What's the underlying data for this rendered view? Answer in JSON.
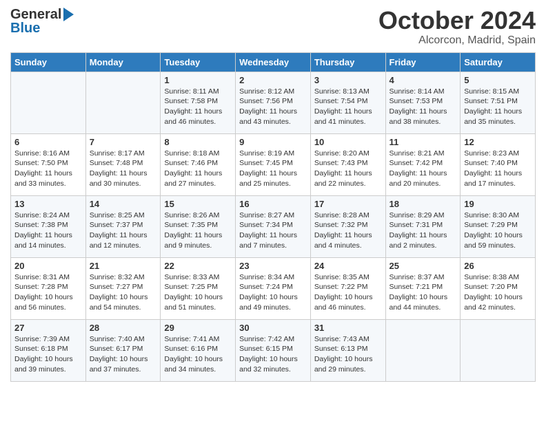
{
  "header": {
    "logo_text_general": "General",
    "logo_text_blue": "Blue",
    "month_title": "October 2024",
    "location": "Alcorcon, Madrid, Spain"
  },
  "calendar": {
    "days_of_week": [
      "Sunday",
      "Monday",
      "Tuesday",
      "Wednesday",
      "Thursday",
      "Friday",
      "Saturday"
    ],
    "weeks": [
      [
        {
          "day": "",
          "content": ""
        },
        {
          "day": "",
          "content": ""
        },
        {
          "day": "1",
          "content": "Sunrise: 8:11 AM\nSunset: 7:58 PM\nDaylight: 11 hours and 46 minutes."
        },
        {
          "day": "2",
          "content": "Sunrise: 8:12 AM\nSunset: 7:56 PM\nDaylight: 11 hours and 43 minutes."
        },
        {
          "day": "3",
          "content": "Sunrise: 8:13 AM\nSunset: 7:54 PM\nDaylight: 11 hours and 41 minutes."
        },
        {
          "day": "4",
          "content": "Sunrise: 8:14 AM\nSunset: 7:53 PM\nDaylight: 11 hours and 38 minutes."
        },
        {
          "day": "5",
          "content": "Sunrise: 8:15 AM\nSunset: 7:51 PM\nDaylight: 11 hours and 35 minutes."
        }
      ],
      [
        {
          "day": "6",
          "content": "Sunrise: 8:16 AM\nSunset: 7:50 PM\nDaylight: 11 hours and 33 minutes."
        },
        {
          "day": "7",
          "content": "Sunrise: 8:17 AM\nSunset: 7:48 PM\nDaylight: 11 hours and 30 minutes."
        },
        {
          "day": "8",
          "content": "Sunrise: 8:18 AM\nSunset: 7:46 PM\nDaylight: 11 hours and 27 minutes."
        },
        {
          "day": "9",
          "content": "Sunrise: 8:19 AM\nSunset: 7:45 PM\nDaylight: 11 hours and 25 minutes."
        },
        {
          "day": "10",
          "content": "Sunrise: 8:20 AM\nSunset: 7:43 PM\nDaylight: 11 hours and 22 minutes."
        },
        {
          "day": "11",
          "content": "Sunrise: 8:21 AM\nSunset: 7:42 PM\nDaylight: 11 hours and 20 minutes."
        },
        {
          "day": "12",
          "content": "Sunrise: 8:23 AM\nSunset: 7:40 PM\nDaylight: 11 hours and 17 minutes."
        }
      ],
      [
        {
          "day": "13",
          "content": "Sunrise: 8:24 AM\nSunset: 7:38 PM\nDaylight: 11 hours and 14 minutes."
        },
        {
          "day": "14",
          "content": "Sunrise: 8:25 AM\nSunset: 7:37 PM\nDaylight: 11 hours and 12 minutes."
        },
        {
          "day": "15",
          "content": "Sunrise: 8:26 AM\nSunset: 7:35 PM\nDaylight: 11 hours and 9 minutes."
        },
        {
          "day": "16",
          "content": "Sunrise: 8:27 AM\nSunset: 7:34 PM\nDaylight: 11 hours and 7 minutes."
        },
        {
          "day": "17",
          "content": "Sunrise: 8:28 AM\nSunset: 7:32 PM\nDaylight: 11 hours and 4 minutes."
        },
        {
          "day": "18",
          "content": "Sunrise: 8:29 AM\nSunset: 7:31 PM\nDaylight: 11 hours and 2 minutes."
        },
        {
          "day": "19",
          "content": "Sunrise: 8:30 AM\nSunset: 7:29 PM\nDaylight: 10 hours and 59 minutes."
        }
      ],
      [
        {
          "day": "20",
          "content": "Sunrise: 8:31 AM\nSunset: 7:28 PM\nDaylight: 10 hours and 56 minutes."
        },
        {
          "day": "21",
          "content": "Sunrise: 8:32 AM\nSunset: 7:27 PM\nDaylight: 10 hours and 54 minutes."
        },
        {
          "day": "22",
          "content": "Sunrise: 8:33 AM\nSunset: 7:25 PM\nDaylight: 10 hours and 51 minutes."
        },
        {
          "day": "23",
          "content": "Sunrise: 8:34 AM\nSunset: 7:24 PM\nDaylight: 10 hours and 49 minutes."
        },
        {
          "day": "24",
          "content": "Sunrise: 8:35 AM\nSunset: 7:22 PM\nDaylight: 10 hours and 46 minutes."
        },
        {
          "day": "25",
          "content": "Sunrise: 8:37 AM\nSunset: 7:21 PM\nDaylight: 10 hours and 44 minutes."
        },
        {
          "day": "26",
          "content": "Sunrise: 8:38 AM\nSunset: 7:20 PM\nDaylight: 10 hours and 42 minutes."
        }
      ],
      [
        {
          "day": "27",
          "content": "Sunrise: 7:39 AM\nSunset: 6:18 PM\nDaylight: 10 hours and 39 minutes."
        },
        {
          "day": "28",
          "content": "Sunrise: 7:40 AM\nSunset: 6:17 PM\nDaylight: 10 hours and 37 minutes."
        },
        {
          "day": "29",
          "content": "Sunrise: 7:41 AM\nSunset: 6:16 PM\nDaylight: 10 hours and 34 minutes."
        },
        {
          "day": "30",
          "content": "Sunrise: 7:42 AM\nSunset: 6:15 PM\nDaylight: 10 hours and 32 minutes."
        },
        {
          "day": "31",
          "content": "Sunrise: 7:43 AM\nSunset: 6:13 PM\nDaylight: 10 hours and 29 minutes."
        },
        {
          "day": "",
          "content": ""
        },
        {
          "day": "",
          "content": ""
        }
      ]
    ]
  }
}
